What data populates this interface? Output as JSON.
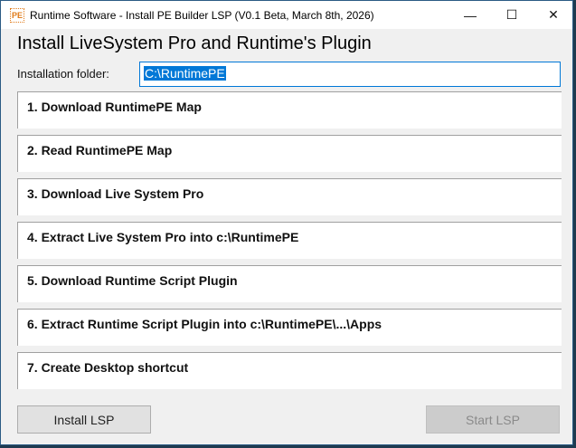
{
  "window": {
    "title": "Runtime Software - Install PE Builder LSP (V0.1 Beta, March 8th, 2026)",
    "icon": "PE",
    "controls": {
      "minimize": "—",
      "maximize": "☐",
      "close": "✕"
    }
  },
  "heading": "Install LiveSystem Pro and Runtime's Plugin",
  "folder": {
    "label": "Installation folder:",
    "value": "C:\\RuntimePE"
  },
  "steps": [
    "1. Download RuntimePE Map",
    "2. Read RuntimePE Map",
    "3. Download Live System Pro",
    "4. Extract Live System Pro into c:\\RuntimePE",
    "5. Download Runtime Script Plugin",
    "6. Extract Runtime Script Plugin into c:\\RuntimePE\\...\\Apps",
    "7. Create Desktop shortcut"
  ],
  "buttons": {
    "install": "Install LSP",
    "start": "Start LSP"
  }
}
